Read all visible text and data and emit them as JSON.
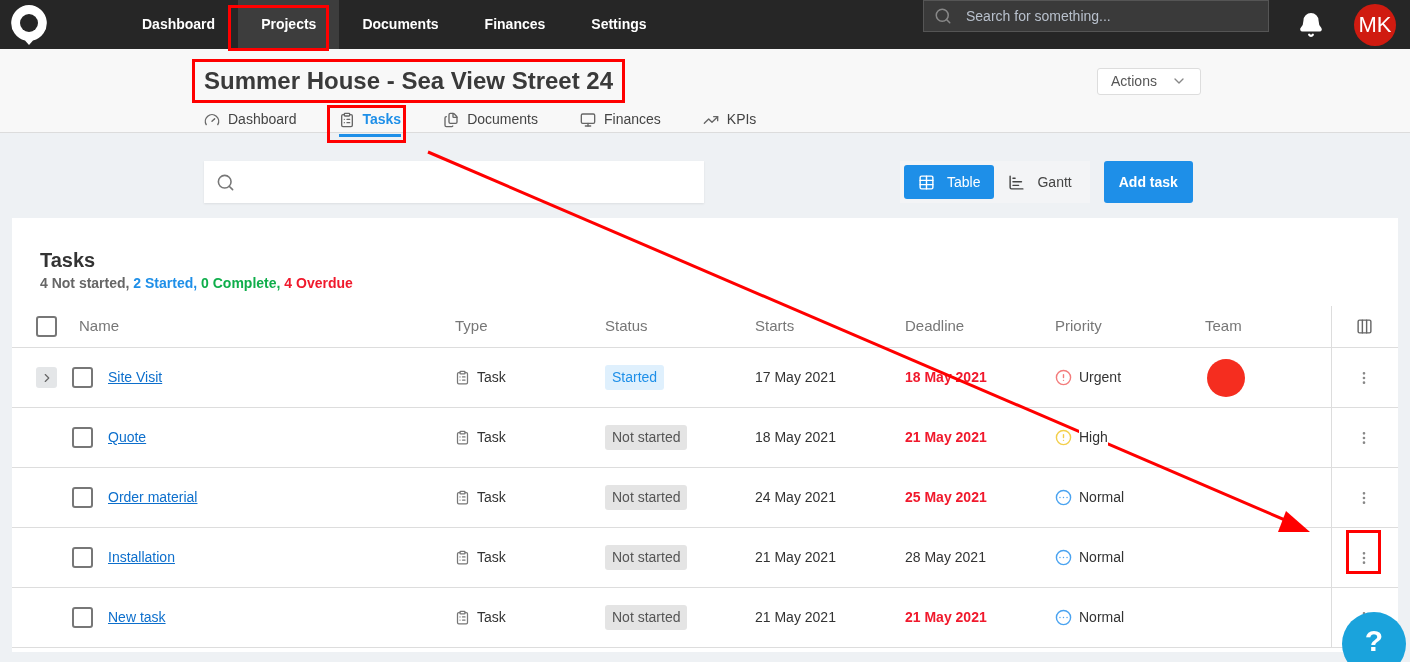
{
  "top_nav": {
    "items": [
      {
        "label": "Dashboard",
        "selected": false
      },
      {
        "label": "Projects",
        "selected": true
      },
      {
        "label": "Documents",
        "selected": false
      },
      {
        "label": "Finances",
        "selected": false
      },
      {
        "label": "Settings",
        "selected": false
      }
    ]
  },
  "search": {
    "placeholder": "Search for something..."
  },
  "user": {
    "initials": "MK"
  },
  "project": {
    "title": "Summer House - Sea View Street 24",
    "actions_label": "Actions"
  },
  "sub_tabs": [
    {
      "label": "Dashboard",
      "kind": "dashboard",
      "selected": false
    },
    {
      "label": "Tasks",
      "kind": "tasks",
      "selected": true
    },
    {
      "label": "Documents",
      "kind": "documents",
      "selected": false
    },
    {
      "label": "Finances",
      "kind": "finances",
      "selected": false
    },
    {
      "label": "KPIs",
      "kind": "kpis",
      "selected": false
    }
  ],
  "toolbar": {
    "views": [
      {
        "label": "Table",
        "kind": "table",
        "selected": true
      },
      {
        "label": "Gantt",
        "kind": "gantt",
        "selected": false
      }
    ],
    "add_button": "Add task"
  },
  "tasks": {
    "title": "Tasks",
    "summary": [
      {
        "text": "4 Not started,",
        "color": "#666666"
      },
      {
        "text": "2 Started,",
        "color": "#1e8fe8"
      },
      {
        "text": "0 Complete,",
        "color": "#0fae4b"
      },
      {
        "text": "4 Overdue",
        "color": "#f0192c"
      }
    ],
    "select_all": {
      "checked": false
    },
    "columns": [
      "Name",
      "Type",
      "Status",
      "Starts",
      "Deadline",
      "Priority",
      "Team"
    ],
    "rows": [
      {
        "name": "Site Visit",
        "expandable": true,
        "checked": false,
        "type": "Task",
        "status": {
          "label": "Started",
          "kind": "started"
        },
        "starts": "17 May 2021",
        "deadline": "18 May 2021",
        "overdue": true,
        "priority": {
          "label": "Urgent",
          "kind": "urgent"
        },
        "team": {
          "color": "#f52d1f"
        }
      },
      {
        "name": "Quote",
        "expandable": false,
        "checked": false,
        "type": "Task",
        "status": {
          "label": "Not started",
          "kind": "not_started"
        },
        "starts": "18 May 2021",
        "deadline": "21 May 2021",
        "overdue": true,
        "priority": {
          "label": "High",
          "kind": "high"
        }
      },
      {
        "name": "Order material",
        "expandable": false,
        "checked": false,
        "type": "Task",
        "status": {
          "label": "Not started",
          "kind": "not_started"
        },
        "starts": "24 May 2021",
        "deadline": "25 May 2021",
        "overdue": true,
        "priority": {
          "label": "Normal",
          "kind": "normal"
        }
      },
      {
        "name": "Installation",
        "expandable": false,
        "checked": false,
        "type": "Task",
        "status": {
          "label": "Not started",
          "kind": "not_started"
        },
        "starts": "21 May 2021",
        "deadline": "28 May 2021",
        "overdue": false,
        "priority": {
          "label": "Normal",
          "kind": "normal"
        }
      },
      {
        "name": "New task",
        "expandable": false,
        "checked": false,
        "type": "Task",
        "status": {
          "label": "Not started",
          "kind": "not_started"
        },
        "starts": "21 May 2021",
        "deadline": "21 May 2021",
        "overdue": true,
        "priority": {
          "label": "Normal",
          "kind": "normal"
        }
      }
    ]
  },
  "help": {
    "label": "?"
  }
}
